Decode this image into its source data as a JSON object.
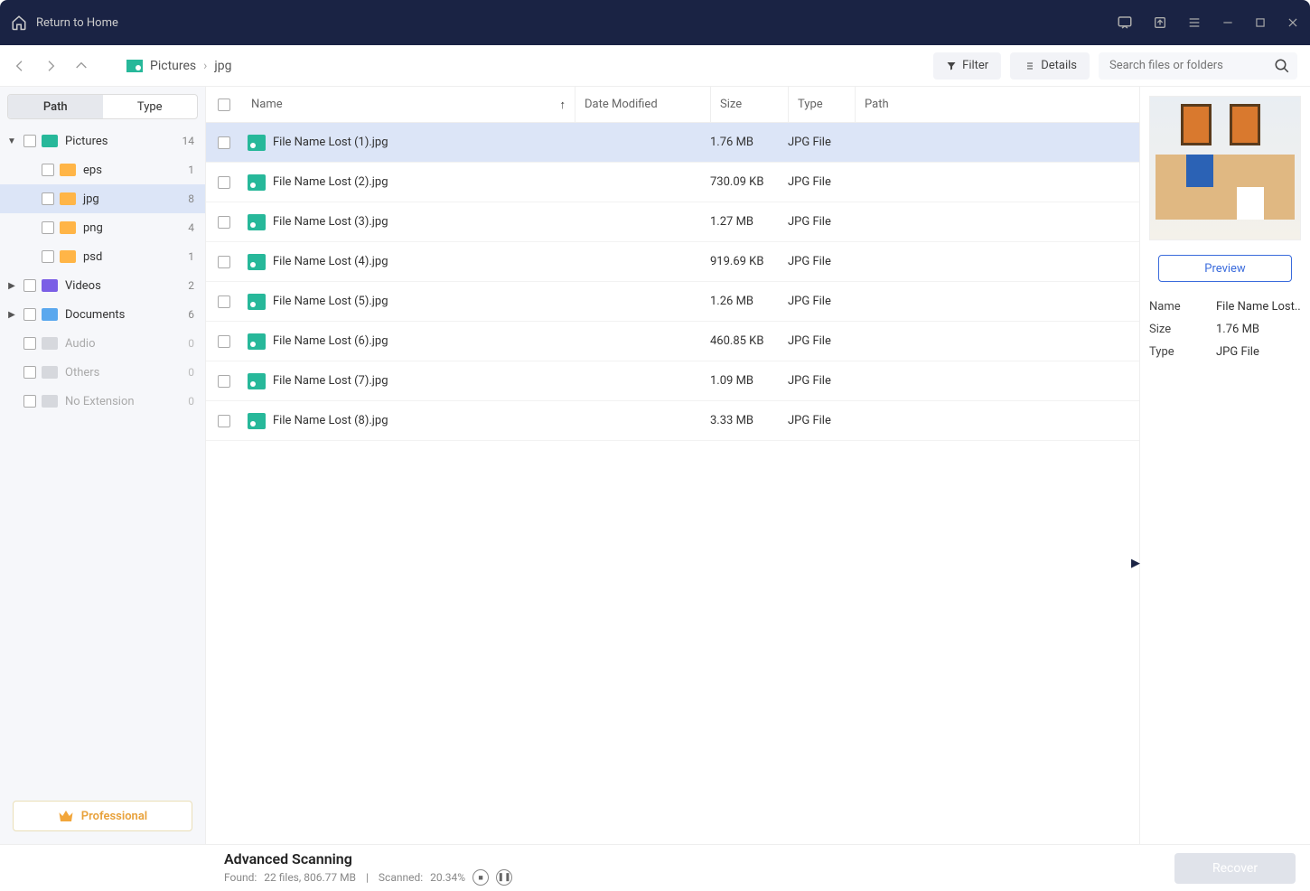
{
  "titlebar": {
    "return_label": "Return to Home"
  },
  "navbar": {
    "breadcrumb": [
      "Pictures",
      "jpg"
    ],
    "filter_label": "Filter",
    "details_label": "Details",
    "search_placeholder": "Search files or folders"
  },
  "sidebar": {
    "segments": {
      "path": "Path",
      "type": "Type"
    },
    "tree": [
      {
        "label": "Pictures",
        "count": "14",
        "depth": 0,
        "icon": "ic-pic",
        "caret": "▼",
        "muted": false,
        "selected": false
      },
      {
        "label": "eps",
        "count": "1",
        "depth": 1,
        "icon": "ic-fold",
        "caret": "",
        "muted": false,
        "selected": false
      },
      {
        "label": "jpg",
        "count": "8",
        "depth": 1,
        "icon": "ic-fold",
        "caret": "",
        "muted": false,
        "selected": true
      },
      {
        "label": "png",
        "count": "4",
        "depth": 1,
        "icon": "ic-fold",
        "caret": "",
        "muted": false,
        "selected": false
      },
      {
        "label": "psd",
        "count": "1",
        "depth": 1,
        "icon": "ic-fold",
        "caret": "",
        "muted": false,
        "selected": false
      },
      {
        "label": "Videos",
        "count": "2",
        "depth": 0,
        "icon": "ic-vid",
        "caret": "▶",
        "muted": false,
        "selected": false
      },
      {
        "label": "Documents",
        "count": "6",
        "depth": 0,
        "icon": "ic-doc",
        "caret": "▶",
        "muted": false,
        "selected": false
      },
      {
        "label": "Audio",
        "count": "0",
        "depth": 0,
        "icon": "ic-mut",
        "caret": "",
        "muted": true,
        "selected": false
      },
      {
        "label": "Others",
        "count": "0",
        "depth": 0,
        "icon": "ic-mut",
        "caret": "",
        "muted": true,
        "selected": false
      },
      {
        "label": "No Extension",
        "count": "0",
        "depth": 0,
        "icon": "ic-mut",
        "caret": "",
        "muted": true,
        "selected": false
      }
    ],
    "pro_label": "Professional"
  },
  "columns": {
    "name": "Name",
    "date": "Date Modified",
    "size": "Size",
    "type": "Type",
    "path": "Path"
  },
  "files": [
    {
      "name": "File Name Lost (1).jpg",
      "size": "1.76 MB",
      "type": "JPG File",
      "selected": true
    },
    {
      "name": "File Name Lost (2).jpg",
      "size": "730.09 KB",
      "type": "JPG File",
      "selected": false
    },
    {
      "name": "File Name Lost (3).jpg",
      "size": "1.27 MB",
      "type": "JPG File",
      "selected": false
    },
    {
      "name": "File Name Lost (4).jpg",
      "size": "919.69 KB",
      "type": "JPG File",
      "selected": false
    },
    {
      "name": "File Name Lost (5).jpg",
      "size": "1.26 MB",
      "type": "JPG File",
      "selected": false
    },
    {
      "name": "File Name Lost (6).jpg",
      "size": "460.85 KB",
      "type": "JPG File",
      "selected": false
    },
    {
      "name": "File Name Lost (7).jpg",
      "size": "1.09 MB",
      "type": "JPG File",
      "selected": false
    },
    {
      "name": "File Name Lost (8).jpg",
      "size": "3.33 MB",
      "type": "JPG File",
      "selected": false
    }
  ],
  "preview": {
    "button": "Preview",
    "name_k": "Name",
    "name_v": "File Name Lost..",
    "size_k": "Size",
    "size_v": "1.76 MB",
    "type_k": "Type",
    "type_v": "JPG File"
  },
  "footer": {
    "title": "Advanced Scanning",
    "found_prefix": "Found: ",
    "found_files": "22 files, 806.77 MB",
    "scanned_prefix": "Scanned: ",
    "scanned_pct": "20.34%",
    "recover_label": "Recover"
  }
}
